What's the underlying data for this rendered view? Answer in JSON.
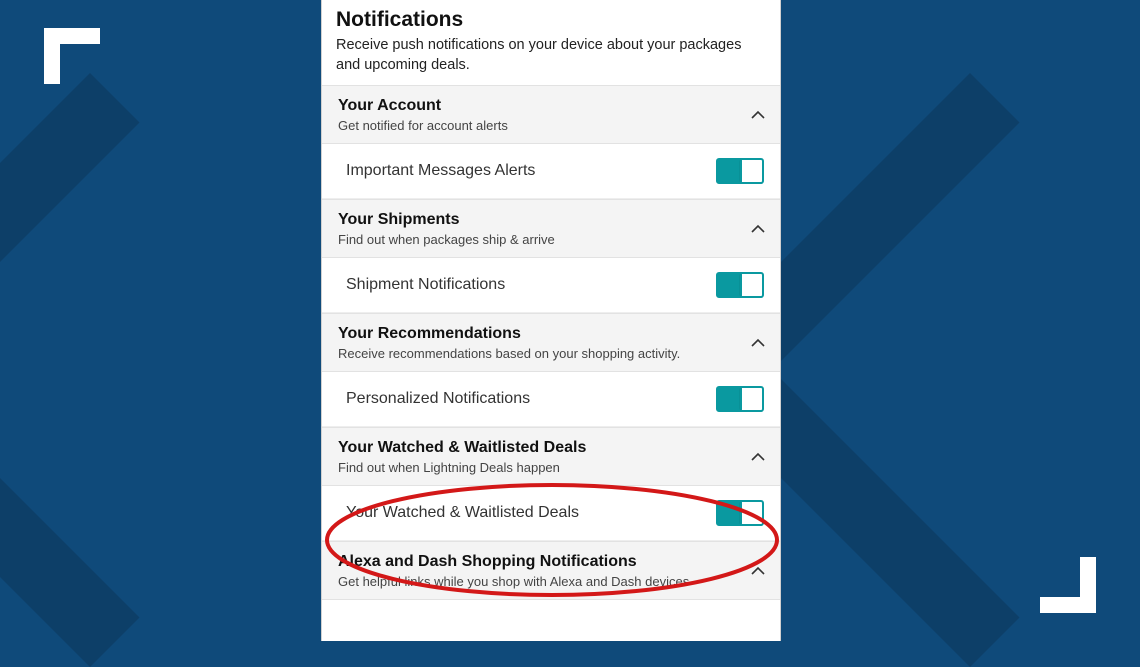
{
  "page": {
    "title": "Notifications",
    "description": "Receive push notifications on your device about your packages and upcoming deals."
  },
  "sections": [
    {
      "id": "account",
      "title": "Your Account",
      "subtitle": "Get notified for account alerts",
      "expanded": true,
      "rows": [
        {
          "id": "important-msgs",
          "label": "Important Messages Alerts",
          "on": true
        }
      ]
    },
    {
      "id": "shipments",
      "title": "Your Shipments",
      "subtitle": "Find out when packages ship & arrive",
      "expanded": true,
      "rows": [
        {
          "id": "shipment-notifs",
          "label": "Shipment Notifications",
          "on": true
        }
      ]
    },
    {
      "id": "recommendations",
      "title": "Your Recommendations",
      "subtitle": "Receive recommendations based on your shopping activity.",
      "expanded": true,
      "rows": [
        {
          "id": "personalized-notifs",
          "label": "Personalized Notifications",
          "on": true
        }
      ]
    },
    {
      "id": "watched-deals",
      "title": "Your Watched & Waitlisted Deals",
      "subtitle": "Find out when Lightning Deals happen",
      "expanded": true,
      "rows": [
        {
          "id": "watched-deals-toggle",
          "label": "Your Watched & Waitlisted Deals",
          "on": true
        }
      ]
    },
    {
      "id": "alexa-dash",
      "title": "Alexa and Dash Shopping Notifications",
      "subtitle": "Get helpful links while you shop with Alexa and Dash devices",
      "expanded": true,
      "rows": []
    }
  ],
  "colors": {
    "bg": "#0f4a7a",
    "bg_dark": "#0d3f68",
    "teal": "#0a99a0",
    "annot": "#d31818"
  },
  "annotation": {
    "target_section": "watched-deals"
  }
}
